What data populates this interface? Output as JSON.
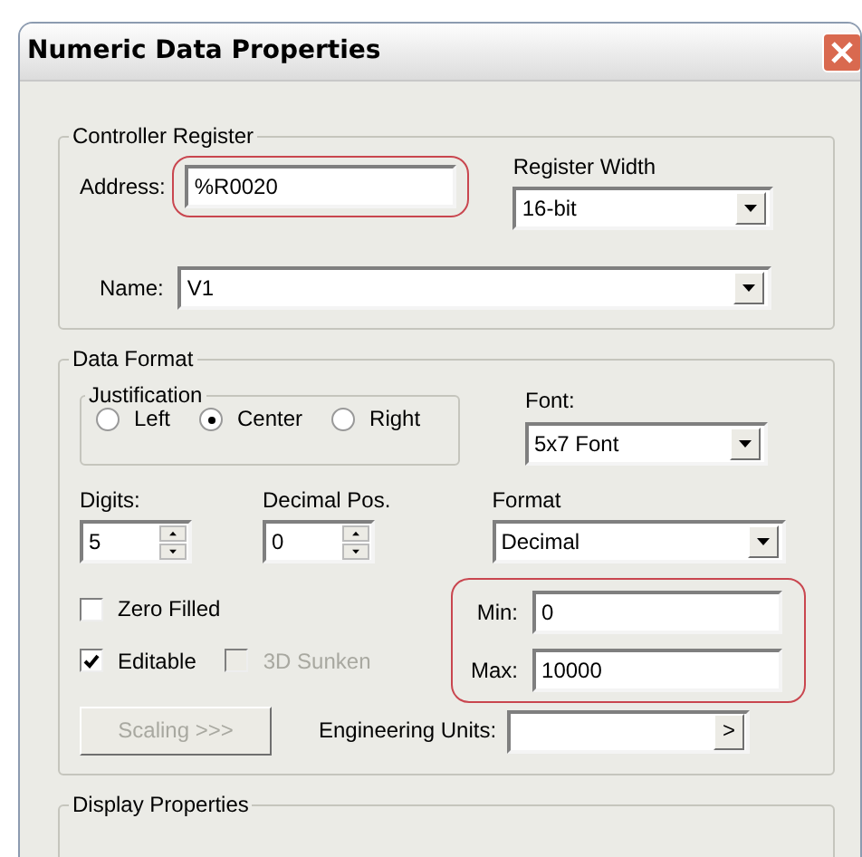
{
  "window": {
    "title": "Numeric Data Properties"
  },
  "controller_register": {
    "title": "Controller Register",
    "address": {
      "label": "Address:",
      "value": "%R0020",
      "highlighted": true
    },
    "register_width": {
      "label": "Register Width",
      "value": "16-bit"
    },
    "name": {
      "label": "Name:",
      "value": "V1"
    }
  },
  "data_format": {
    "title": "Data Format",
    "justification": {
      "title": "Justification",
      "options": [
        {
          "label": "Left",
          "selected": false
        },
        {
          "label": "Center",
          "selected": true
        },
        {
          "label": "Right",
          "selected": false
        }
      ]
    },
    "font": {
      "label": "Font:",
      "value": "5x7 Font"
    },
    "digits": {
      "label": "Digits:",
      "value": "5"
    },
    "decimal_pos": {
      "label": "Decimal Pos.",
      "value": "0"
    },
    "format": {
      "label": "Format",
      "value": "Decimal"
    },
    "checkboxes": [
      {
        "label": "Zero Filled",
        "checked": false,
        "disabled": false
      },
      {
        "label": "Editable",
        "checked": true,
        "disabled": false
      },
      {
        "label": "3D Sunken",
        "checked": false,
        "disabled": true
      }
    ],
    "range_highlighted": true,
    "min": {
      "label": "Min:",
      "value": "0"
    },
    "max": {
      "label": "Max:",
      "value": "10000"
    },
    "scaling_button": {
      "label": "Scaling >>>",
      "disabled": true
    },
    "engineering_units": {
      "label": "Engineering Units:",
      "button": ">"
    }
  },
  "display_properties": {
    "title": "Display Properties"
  }
}
